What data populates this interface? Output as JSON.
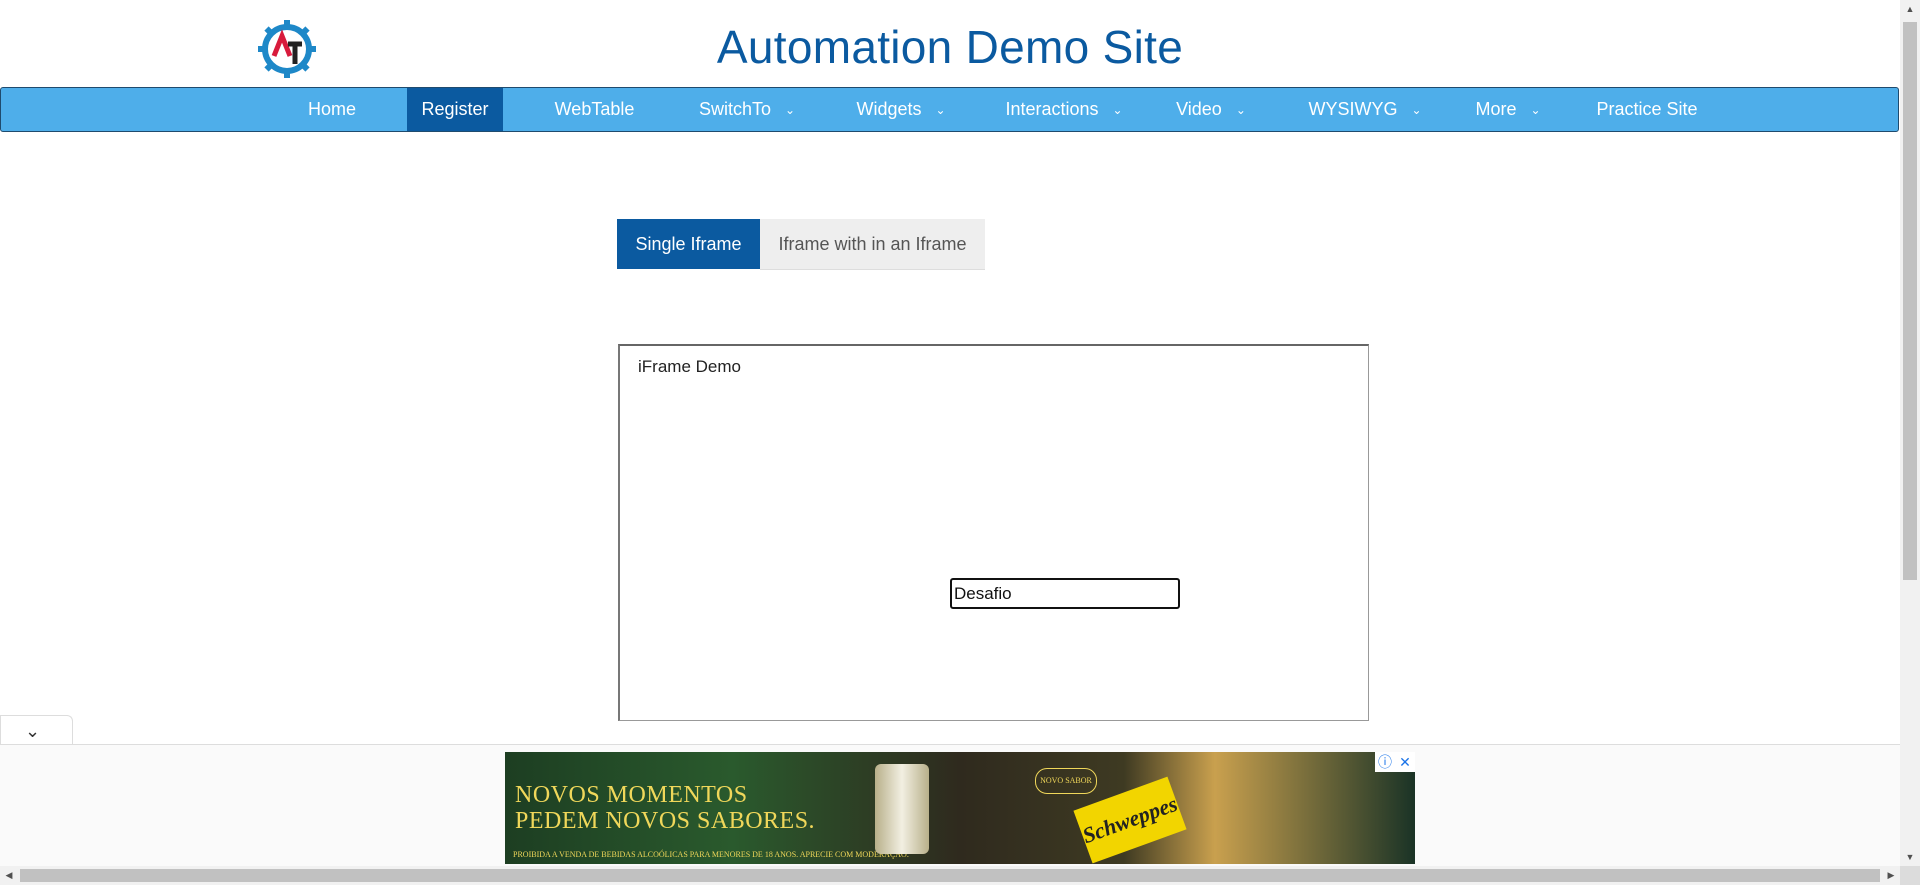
{
  "header": {
    "title": "Automation Demo Site",
    "logo_letters": "AT",
    "brand_color": "#0b5aa0"
  },
  "nav": {
    "items": [
      {
        "label": "Home",
        "active": false,
        "dropdown": false
      },
      {
        "label": "Register",
        "active": true,
        "dropdown": false
      },
      {
        "label": "WebTable",
        "active": false,
        "dropdown": false
      },
      {
        "label": "SwitchTo",
        "active": false,
        "dropdown": true
      },
      {
        "label": "Widgets",
        "active": false,
        "dropdown": true
      },
      {
        "label": "Interactions",
        "active": false,
        "dropdown": true
      },
      {
        "label": "Video",
        "active": false,
        "dropdown": true
      },
      {
        "label": "WYSIWYG",
        "active": false,
        "dropdown": true
      },
      {
        "label": "More",
        "active": false,
        "dropdown": true
      },
      {
        "label": "Practice Site",
        "active": false,
        "dropdown": false
      }
    ],
    "bar_color": "#4eaeea",
    "active_color": "#0b5aa0"
  },
  "tabs": [
    {
      "label": "Single Iframe",
      "active": true
    },
    {
      "label": "Iframe with in an Iframe",
      "active": false
    }
  ],
  "iframe": {
    "title": "iFrame Demo",
    "input_value": "Desafio"
  },
  "ad": {
    "line1": "NOVOS MOMENTOS",
    "line2": "PEDEM NOVOS SABORES.",
    "disclaimer": "PROIBIDA A VENDA DE BEBIDAS ALCOÓLICAS PARA MENORES DE 18 ANOS. APRECIE COM MODERAÇÃO.",
    "badge": "NOVO SABOR",
    "brand": "Schweppes",
    "info_icon": "info-icon",
    "close_icon": "close-icon"
  },
  "collapse_icon": "chevron-down-icon"
}
